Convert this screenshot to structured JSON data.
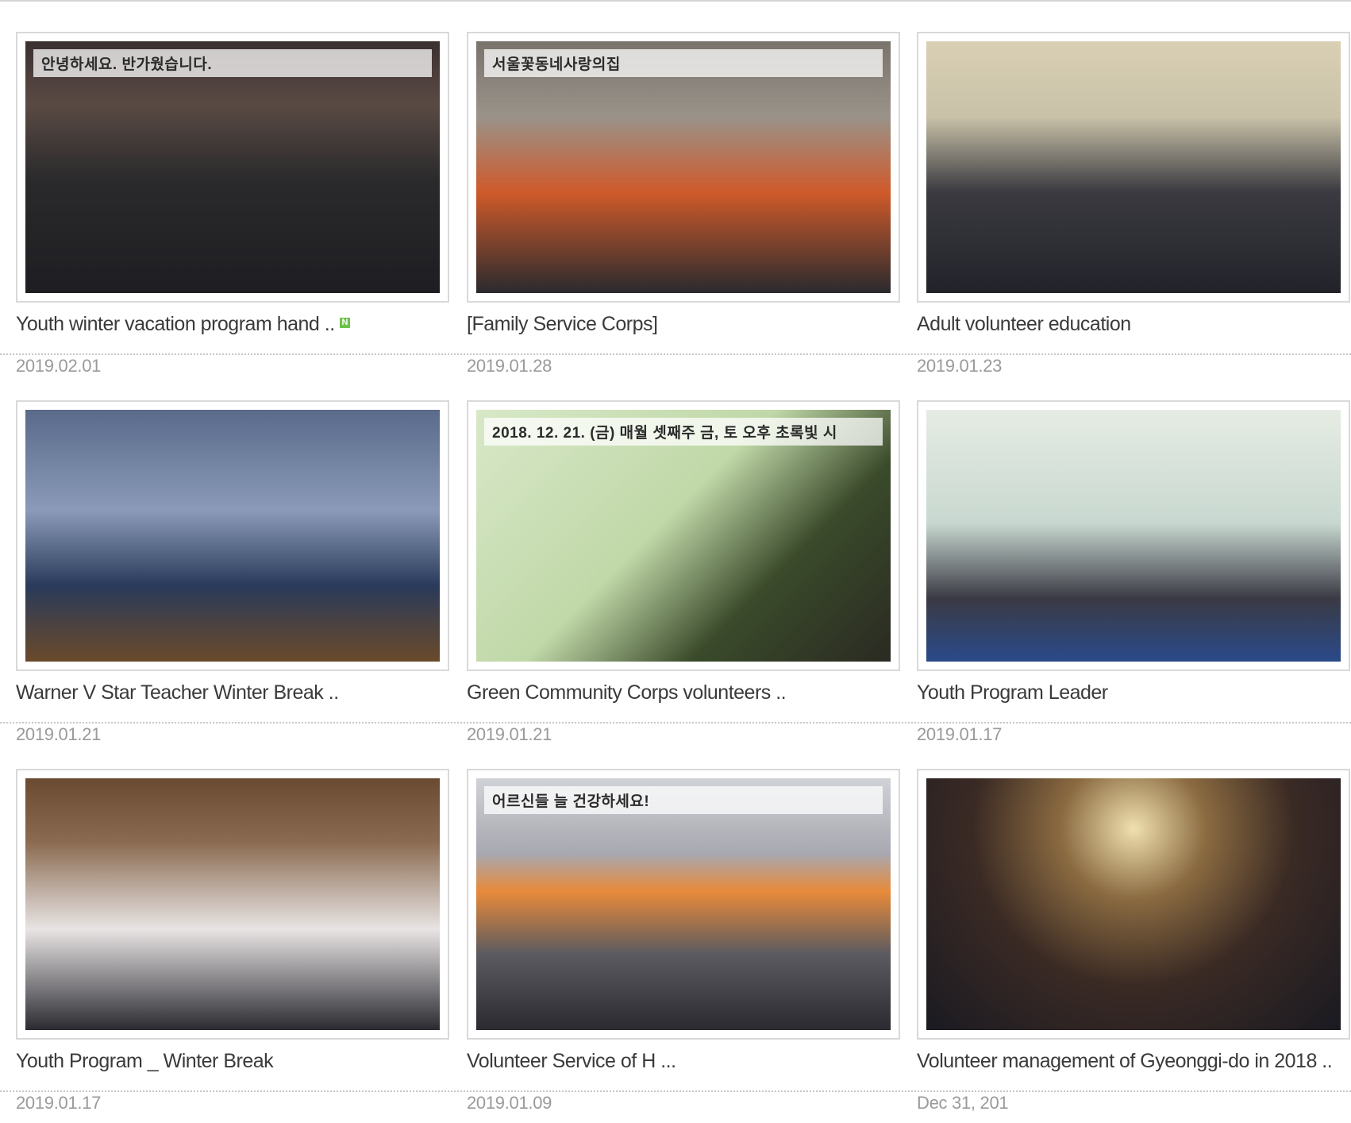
{
  "gallery": {
    "new_badge": "N",
    "rows": [
      [
        {
          "title": "Youth winter vacation program hand ..",
          "date": "2019.02.01",
          "is_new": true,
          "photo_text": "안녕하세요. 반가웠습니다."
        },
        {
          "title": "[Family Service Corps]",
          "date": "2019.01.28",
          "is_new": false,
          "photo_text": "서울꽃동네사랑의집"
        },
        {
          "title": "Adult volunteer education",
          "date": "2019.01.23",
          "is_new": false,
          "photo_text": ""
        }
      ],
      [
        {
          "title": "Warner V Star Teacher Winter Break ..",
          "date": "2019.01.21",
          "is_new": false,
          "photo_text": ""
        },
        {
          "title": "Green Community Corps volunteers ..",
          "date": "2019.01.21",
          "is_new": false,
          "photo_text": "2018. 12. 21. (금) 매월 셋째주 금, 토 오후 초록빛 시"
        },
        {
          "title": "Youth Program Leader",
          "date": "2019.01.17",
          "is_new": false,
          "photo_text": ""
        }
      ],
      [
        {
          "title": "Youth Program _ Winter Break",
          "date": "2019.01.17",
          "is_new": false,
          "photo_text": ""
        },
        {
          "title": "Volunteer Service of H ...",
          "date": "2019.01.09",
          "is_new": false,
          "photo_text": "어르신들 늘 건강하세요!"
        },
        {
          "title": "Volunteer management of Gyeonggi-do in 2018 ..",
          "date": "Dec 31, 201",
          "is_new": false,
          "photo_text": ""
        }
      ]
    ]
  }
}
